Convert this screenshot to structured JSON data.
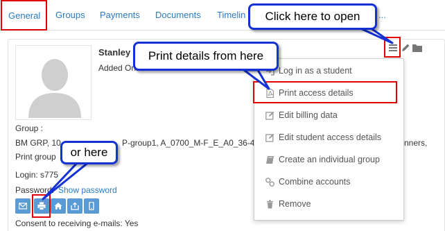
{
  "tabs": [
    {
      "label": "General"
    },
    {
      "label": "Groups"
    },
    {
      "label": "Payments"
    },
    {
      "label": "Documents"
    },
    {
      "label": "Timelin"
    },
    {
      "label": "..."
    }
  ],
  "student": {
    "name": "Stanley",
    "added_on": "Added On: 05/06/2015",
    "group_label": "Group :",
    "group_line1_left": "BM GRP, 10",
    "group_line1_mid": "P-group1, A_0700_M-F_E_A0_36-4",
    "group_line1_right": "nners,",
    "group_line2": "Print group",
    "login_label": "Login: s775",
    "password_label": "Password:",
    "password_link": "Show password",
    "consent": "Consent to receiving e-mails: Yes"
  },
  "menu": {
    "items": [
      {
        "label": "Log in as a student",
        "icon": "sign-in-icon"
      },
      {
        "label": "Print access details",
        "icon": "pdf-icon"
      },
      {
        "label": "Edit billing data",
        "icon": "edit-icon"
      },
      {
        "label": "Edit student access details",
        "icon": "edit-icon"
      },
      {
        "label": "Create an individual group",
        "icon": "book-icon"
      },
      {
        "label": "Combine accounts",
        "icon": "link-icon"
      },
      {
        "label": "Remove",
        "icon": "trash-icon"
      }
    ]
  },
  "callouts": {
    "open": "Click here to open",
    "print": "Print details from here",
    "or_here": "or here"
  },
  "colors": {
    "accent": "#2a7ac2",
    "highlight": "#e00000",
    "callout_border": "#1431d6",
    "button": "#5b9bd5"
  }
}
